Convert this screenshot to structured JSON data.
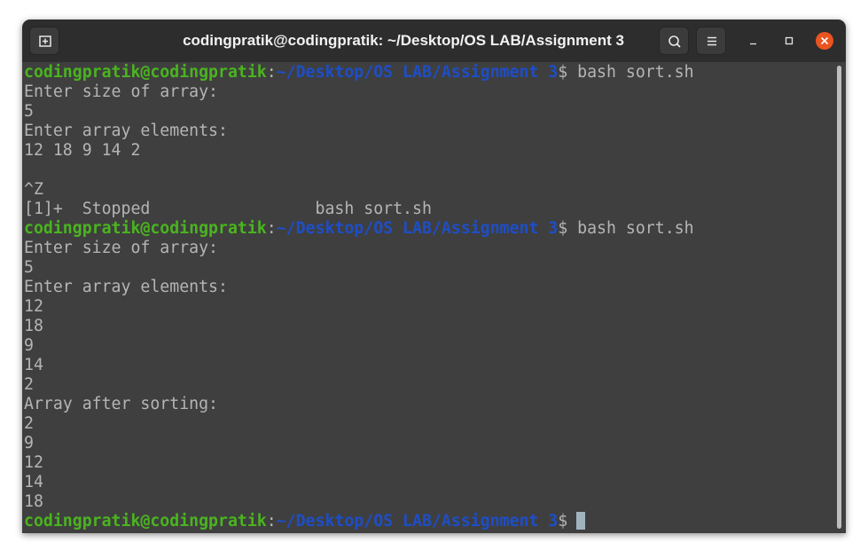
{
  "window": {
    "title": "codingpratik@codingpratik: ~/Desktop/OS LAB/Assignment 3"
  },
  "prompt": {
    "user_host": "codingpratik@codingpratik",
    "colon": ":",
    "path": "~/Desktop/OS LAB/Assignment 3",
    "dollar": "$"
  },
  "terminal": {
    "cmd1": " bash sort.sh",
    "out1": [
      "Enter size of array:",
      "5",
      "Enter array elements:",
      "12 18 9 14 2",
      "",
      "^Z",
      "[1]+  Stopped                 bash sort.sh"
    ],
    "cmd2": " bash sort.sh",
    "out2": [
      "Enter size of array:",
      "5",
      "Enter array elements:",
      "12",
      "18",
      "9",
      "14",
      "2",
      "Array after sorting:",
      "2",
      "9",
      "12",
      "14",
      "18"
    ]
  },
  "icons": {
    "new_tab": "new-tab-icon",
    "search": "search-icon",
    "menu": "hamburger-menu-icon",
    "minimize": "minimize-icon",
    "maximize": "maximize-icon",
    "close": "close-icon"
  },
  "colors": {
    "user_host": "#4ab41f",
    "path": "#1e4ec6",
    "text": "#b5b5b5",
    "background": "#3f3f3f",
    "titlebar": "#2d2d2d",
    "close_button": "#e95420"
  }
}
